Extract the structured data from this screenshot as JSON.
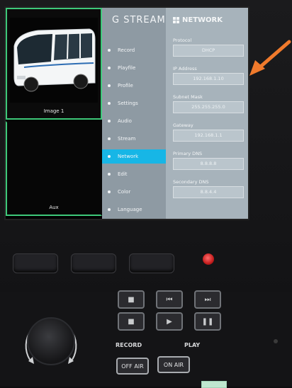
{
  "brand": "G STREAM",
  "thumbnails": [
    {
      "label": "Image 1"
    },
    {
      "label": "Aux"
    }
  ],
  "menu": {
    "items": [
      {
        "label": "Record",
        "active": false
      },
      {
        "label": "Playfile",
        "active": false
      },
      {
        "label": "Profile",
        "active": false
      },
      {
        "label": "Settings",
        "active": false
      },
      {
        "label": "Audio",
        "active": false
      },
      {
        "label": "Stream",
        "active": false
      },
      {
        "label": "Network",
        "active": true
      },
      {
        "label": "Edit",
        "active": false
      },
      {
        "label": "Color",
        "active": false
      },
      {
        "label": "Language",
        "active": false
      }
    ]
  },
  "network": {
    "title": "NETWORK",
    "fields": [
      {
        "label": "Protocol",
        "value": "DHCP"
      },
      {
        "label": "IP Address",
        "value": "192.168.1.10"
      },
      {
        "label": "Subnet Mask",
        "value": "255.255.255.0"
      },
      {
        "label": "Gateway",
        "value": "192.168.1.1"
      },
      {
        "label": "Primary DNS",
        "value": "8.8.8.8"
      },
      {
        "label": "Secondary DNS",
        "value": "8.8.4.4"
      }
    ]
  },
  "deck": {
    "record_label": "RECORD",
    "play_label": "PLAY",
    "key_on_air": "ON AIR",
    "key_off_air": "OFF AIR"
  },
  "colors": {
    "accent": "#17b6e6",
    "border_green": "#3ec97a",
    "arrow": "#f07a2c",
    "led_red": "#d22a2a"
  }
}
